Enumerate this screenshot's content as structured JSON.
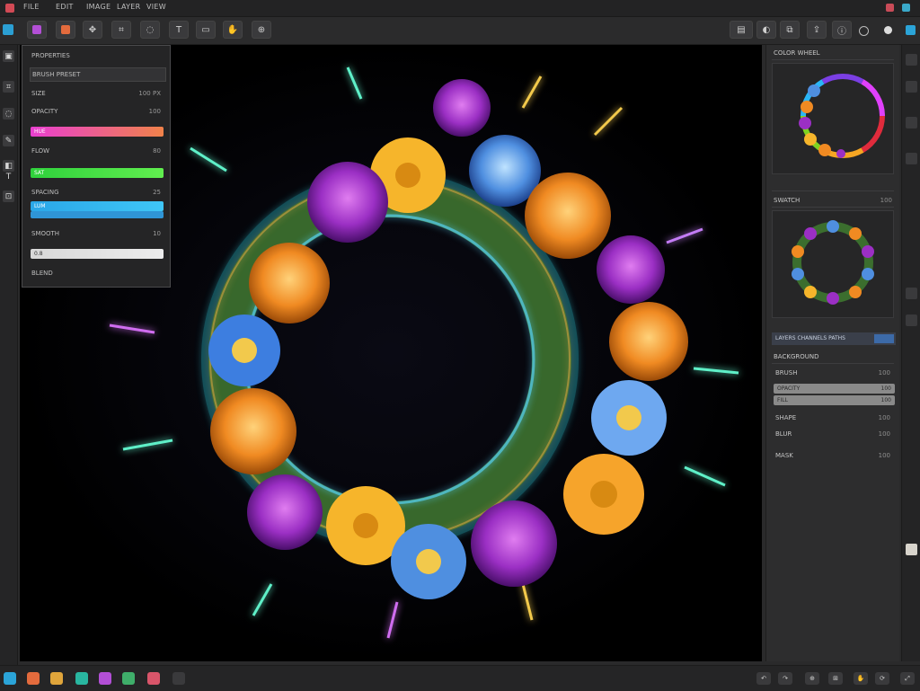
{
  "menubar": {
    "items": [
      "FILE",
      "EDIT",
      "IMAGE",
      "LAYER",
      "VIEW"
    ],
    "accent": "#d24a55"
  },
  "toolbar": {
    "left_tools": [
      "brush-icon",
      "color-icon",
      "move-icon",
      "crop-icon",
      "lasso-icon",
      "text-icon",
      "shape-icon",
      "hand-icon",
      "zoom-icon"
    ],
    "right_tools": [
      "layers-icon",
      "adjust-icon",
      "filter-icon",
      "export-icon",
      "info-icon",
      "settings-icon"
    ]
  },
  "properties_panel": {
    "title": "PROPERTIES",
    "rows": [
      {
        "label": "BRUSH PRESET",
        "value": ""
      },
      {
        "label": "SIZE",
        "value": "100 PX"
      },
      {
        "label": "OPACITY",
        "value": "100"
      },
      {
        "label": "FLOW",
        "value": "80"
      },
      {
        "label": "SPACING",
        "value": "25"
      },
      {
        "label": "SMOOTH",
        "value": "10"
      },
      {
        "label": "BLEND",
        "value": ""
      }
    ],
    "bars": [
      {
        "label": "HUE",
        "color_from": "#e93fd0",
        "color_to": "#f0824a"
      },
      {
        "label": "SAT",
        "color_from": "#2fd13c",
        "color_to": "#61ef4f"
      },
      {
        "label": "LUM",
        "color_from": "#2aa7e8",
        "color_to": "#3fc6f6"
      },
      {
        "label": "0.8",
        "color_from": "#d8d8d8",
        "color_to": "#ececec"
      }
    ]
  },
  "right_panel": {
    "color_header": "COLOR WHEEL",
    "color_value": "",
    "swatch_header": "SWATCH",
    "swatch_value": "100",
    "tabs_row": "LAYERS  CHANNELS  PATHS",
    "background_header": "BACKGROUND",
    "rows": [
      {
        "label": "BRUSH",
        "value": "100"
      },
      {
        "label": "SHAPE",
        "value": "100"
      },
      {
        "label": "BLUR",
        "value": "100"
      },
      {
        "label": "MASK",
        "value": "100"
      }
    ],
    "sliders": [
      {
        "label": "OPACITY",
        "value": "100"
      },
      {
        "label": "FILL",
        "value": "100"
      }
    ]
  },
  "bottom_bar": {
    "left_icons": [
      "layer-icon",
      "brush-icon",
      "palette-icon",
      "gradient-icon",
      "filter-icon",
      "mask-icon",
      "settings-icon"
    ],
    "right_icons": [
      "undo-icon",
      "redo-icon",
      "zoom-icon",
      "grid-icon",
      "hand-icon",
      "rotate-icon",
      "fullscreen-icon"
    ]
  }
}
